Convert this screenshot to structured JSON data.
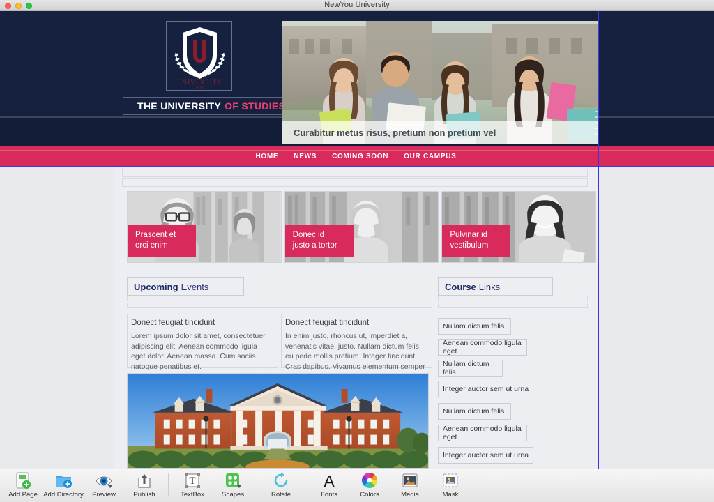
{
  "window": {
    "title": "NewYou University"
  },
  "site": {
    "brand": {
      "part1": "THE UNIVERSITY",
      "part2": "OF STUDIES"
    },
    "crest": {
      "letter": "U",
      "name": "UNIVERSITY",
      "year": "1876"
    },
    "hero": {
      "caption": "Curabitur metus risus, pretium non pretium vel"
    },
    "nav": [
      {
        "label": "HOME"
      },
      {
        "label": "NEWS"
      },
      {
        "label": "COMING SOON"
      },
      {
        "label": "OUR CAMPUS"
      }
    ],
    "cards": [
      {
        "title_line1": "Prascent et",
        "title_line2": "orci enim"
      },
      {
        "title_line1": "Donec id",
        "title_line2": "justo a tortor"
      },
      {
        "title_line1": "Pulvinar id",
        "title_line2": "vestibulum"
      }
    ],
    "events": {
      "heading_bold": "Upcoming",
      "heading_normal": "Events",
      "columns": [
        {
          "subhead": "Donect feugiat tincidunt",
          "body": "Lorem ipsum dolor sit amet, consectetuer adipiscing elit. Aenean commodo ligula eget dolor. Aenean massa. Cum sociis natoque penatibus et."
        },
        {
          "subhead": "Donect feugiat tincidunt",
          "body": "In enim justo, rhoncus ut, imperdiet a, venenatis vitae, justo. Nullam dictum felis eu pede mollis pretium. Integer tincidunt. Cras dapibus. Vivamus elementum semper nisi. Aenean"
        }
      ]
    },
    "courses": {
      "heading_bold": "Course",
      "heading_normal": "Links",
      "links": [
        {
          "label": "Nullam dictum felis"
        },
        {
          "label": "Aenean commodo ligula eget"
        },
        {
          "label": "Nullam dictum felis"
        },
        {
          "label": "Integer auctor sem ut urna"
        },
        {
          "label": "Nullam dictum felis"
        },
        {
          "label": "Aenean commodo ligula eget"
        },
        {
          "label": "Integer auctor sem ut urna"
        }
      ]
    }
  },
  "toolbar": {
    "items": [
      {
        "label": "Add Page",
        "icon": "add-page-icon"
      },
      {
        "label": "Add Directory",
        "icon": "add-directory-icon"
      },
      {
        "label": "Preview",
        "icon": "preview-eye-icon"
      },
      {
        "label": "Publish",
        "icon": "publish-upload-icon"
      },
      {
        "label": "TextBox",
        "icon": "textbox-icon"
      },
      {
        "label": "Shapes",
        "icon": "shapes-icon"
      },
      {
        "label": "Rotate",
        "icon": "rotate-icon"
      },
      {
        "label": "Fonts",
        "icon": "fonts-icon"
      },
      {
        "label": "Colors",
        "icon": "colors-wheel-icon"
      },
      {
        "label": "Media",
        "icon": "media-image-icon"
      },
      {
        "label": "Mask",
        "icon": "mask-icon"
      }
    ]
  },
  "colors": {
    "navy": "#16213f",
    "pink": "#d92a5c",
    "crest_red": "#8c1d2c",
    "guide_blue": "#3b36e8",
    "page_bg": "#e9eaee"
  }
}
